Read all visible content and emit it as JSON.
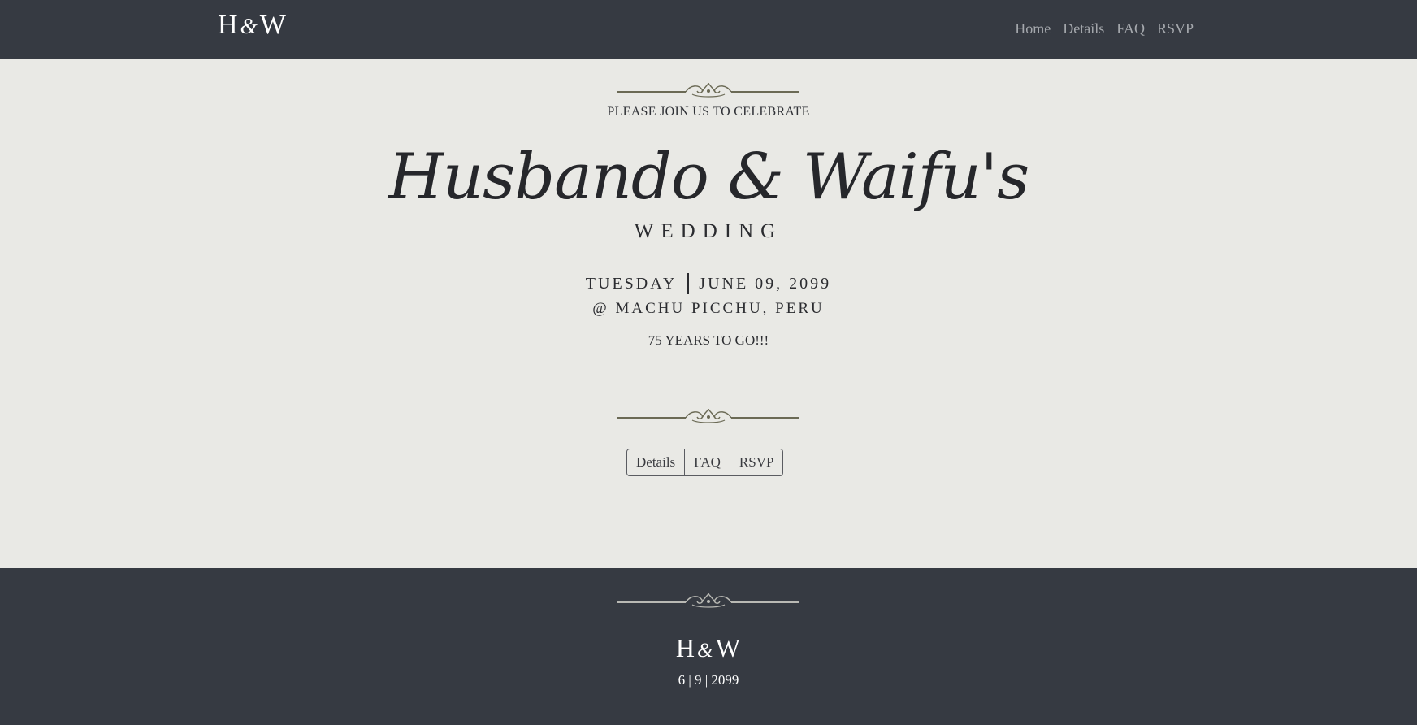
{
  "nav": {
    "brand_h": "H",
    "brand_amp": "&",
    "brand_w": "W",
    "links": [
      "Home",
      "Details",
      "FAQ",
      "RSVP"
    ]
  },
  "hero": {
    "invite": "PLEASE JOIN US TO CELEBRATE",
    "names": "Husbando & Waifu's",
    "wedding": "WEDDING",
    "day": "TUESDAY",
    "date": "JUNE 09, 2099",
    "location": "@ MACHU PICCHU, PERU",
    "countdown": "75 YEARS TO GO!!!",
    "buttons": [
      "Details",
      "FAQ",
      "RSVP"
    ]
  },
  "footer": {
    "brand_h": "H",
    "brand_amp": "&",
    "brand_w": "W",
    "date": "6 | 9 | 2099"
  },
  "colors": {
    "navbar_bg": "#363a42",
    "hero_bg": "#e9e9e5",
    "ornament": "#6b6a55"
  },
  "icons": [
    "flourish-divider-icon"
  ]
}
